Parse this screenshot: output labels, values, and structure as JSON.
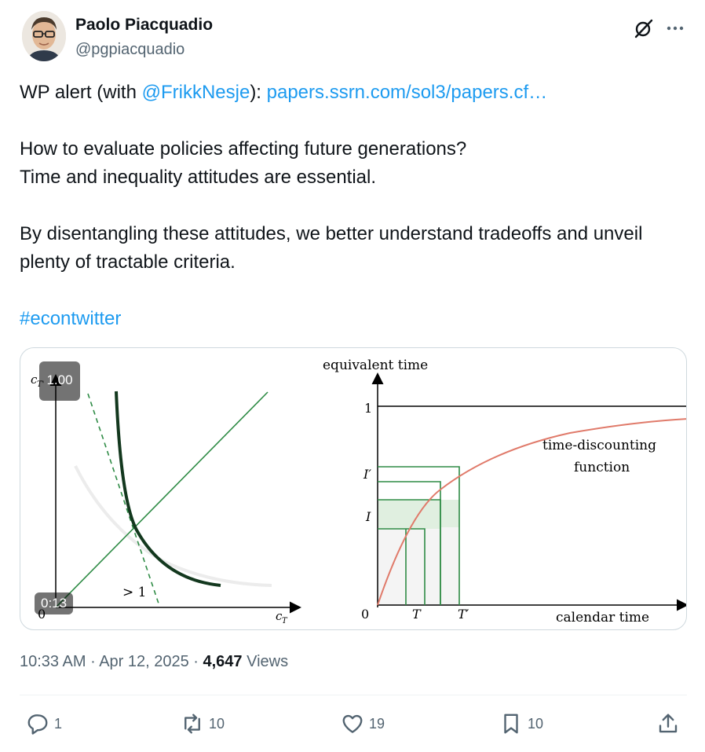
{
  "author": {
    "name": "Paolo Piacquadio",
    "handle": "@pgpiacquadio"
  },
  "tweet": {
    "line1_prefix": "WP alert (with ",
    "mention": "@FrikkNesje",
    "line1_sep": "): ",
    "url": "papers.ssrn.com/sol3/papers.cf…",
    "line2": "How to evaluate policies affecting future generations?",
    "line3": "Time and inequality attitudes are essential.",
    "line4": "By disentangling these attitudes, we better understand tradeoffs and unveil plenty of tractable criteria.",
    "hashtag": "#econtwitter"
  },
  "media": {
    "left_top_pill": "1.00",
    "video_time": "0:13",
    "left_plot": {
      "y_label": "c",
      "y_label_sub": "T'",
      "x_label": "c",
      "x_label_sub": "T",
      "origin": "0",
      "slope_label": "> 1"
    },
    "right_plot": {
      "y_axis_title": "equivalent time",
      "x_axis_title": "calendar time",
      "y_tick_1": "1",
      "y_tick_Iprime": "I′",
      "y_tick_I": "I",
      "origin": "0",
      "x_tick_T": "T",
      "x_tick_Tprime": "T′",
      "curve_label_1": "time-discounting",
      "curve_label_2": "function"
    }
  },
  "meta": {
    "time": "10:33 AM",
    "sep1": " · ",
    "date": "Apr 12, 2025",
    "sep2": " · ",
    "views_count": "4,647",
    "views_label": " Views"
  },
  "actions": {
    "replies": "1",
    "reposts": "10",
    "likes": "19",
    "bookmarks": "10"
  },
  "colors": {
    "link": "#1d9bf0",
    "secondary": "#536471",
    "dark_green": "#1a3d22",
    "green": "#2e8b45",
    "curve_red": "#e07a6a"
  }
}
